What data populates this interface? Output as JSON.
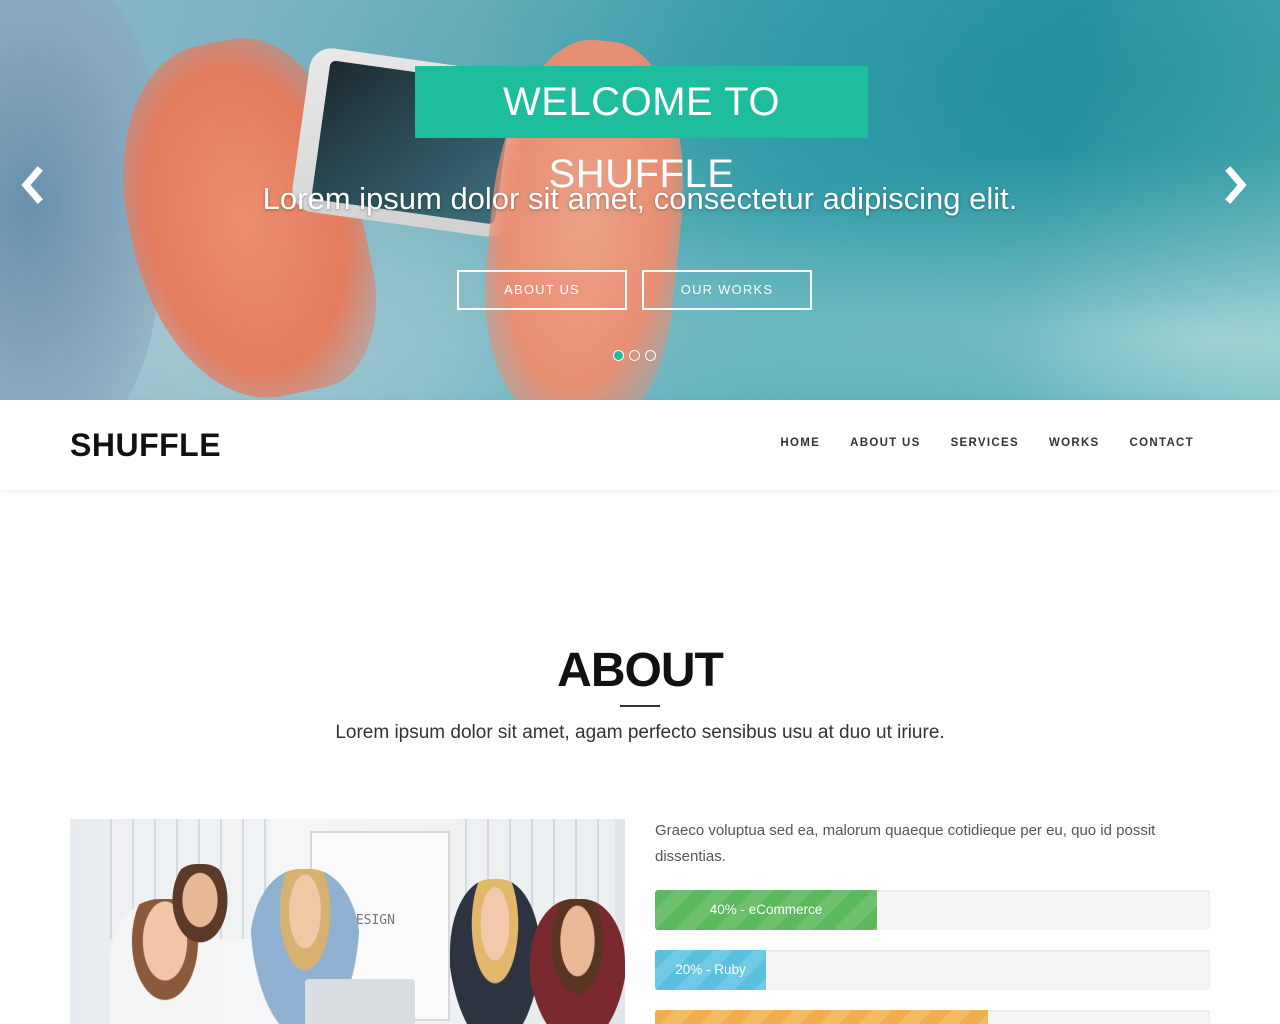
{
  "hero": {
    "title": "WELCOME TO SHUFFLE",
    "subtitle": "Lorem ipsum dolor sit amet, consectetur adipiscing elit.",
    "buttons": [
      {
        "label": "ABOUT US"
      },
      {
        "label": "OUR WORKS"
      }
    ],
    "prev_icon": "chevron-left-icon",
    "next_icon": "chevron-right-icon",
    "slides": 3,
    "active_slide": 1,
    "accent": "#1ebd9e"
  },
  "navbar": {
    "brand": "SHUFFLE",
    "items": [
      {
        "label": "HOME"
      },
      {
        "label": "ABOUT US"
      },
      {
        "label": "SERVICES"
      },
      {
        "label": "WORKS"
      },
      {
        "label": "CONTACT"
      }
    ]
  },
  "about": {
    "title": "ABOUT",
    "lead": "Lorem ipsum dolor sit amet, agam perfecto sensibus usu at duo ut iriure.",
    "text": "Graeco voluptua sed ea, malorum quaeque cotidieque per eu, quo id possit dissentias.",
    "image_board_text": "DESIGN",
    "skills": [
      {
        "label": "40% - eCommerce",
        "percent": 40,
        "color": "#5cb85c"
      },
      {
        "label": "20% - Ruby",
        "percent": 20,
        "color": "#5bc0de"
      },
      {
        "label": "",
        "percent": 60,
        "color": "#f0ad4e"
      }
    ]
  }
}
